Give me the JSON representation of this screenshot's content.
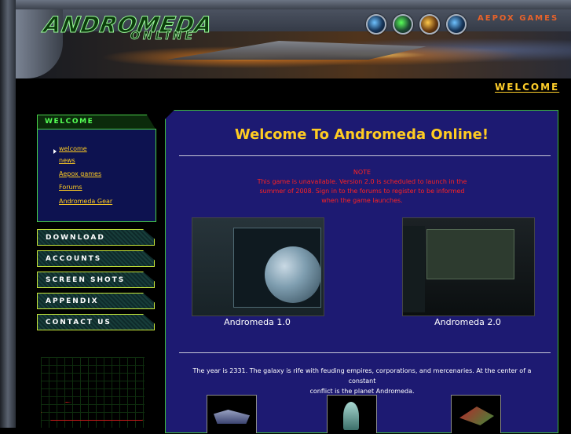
{
  "header": {
    "logo_top": "ANDROMEDA",
    "logo_bottom": "ONLINE",
    "aepox_label": "AEPOX GAMES",
    "section_title": "WELCOME"
  },
  "sidebar": {
    "heading": "WELCOME",
    "links": [
      "welcome",
      "news",
      "Aepox games",
      "Forums",
      "Andromeda Gear"
    ],
    "buttons": [
      "DOWNLOAD",
      "ACCOUNTS",
      "SCREEN SHOTS",
      "APPENDIX",
      "CONTACT US"
    ]
  },
  "main": {
    "title": "Welcome To Andromeda Online!",
    "note": {
      "heading": "NOTE",
      "lines": [
        "This game is unavailable.  Version 2.0 is scheduled to launch in the",
        "summer of 2008.  Sign in to the forums to register to be informed",
        "when the game launches."
      ]
    },
    "screenshots": [
      {
        "caption": "Andromeda 1.0"
      },
      {
        "caption": "Andromeda 2.0"
      }
    ],
    "intro_lines": [
      "The year is 2331. The galaxy is rife with feuding empires, corporations, and mercenaries. At the center of a constant",
      "conflict is the planet Andromeda."
    ]
  },
  "colors": {
    "accent_yellow": "#ffcc22",
    "panel_blue": "#1d1a72",
    "nav_green": "#54ff54",
    "note_red": "#ff2222"
  }
}
